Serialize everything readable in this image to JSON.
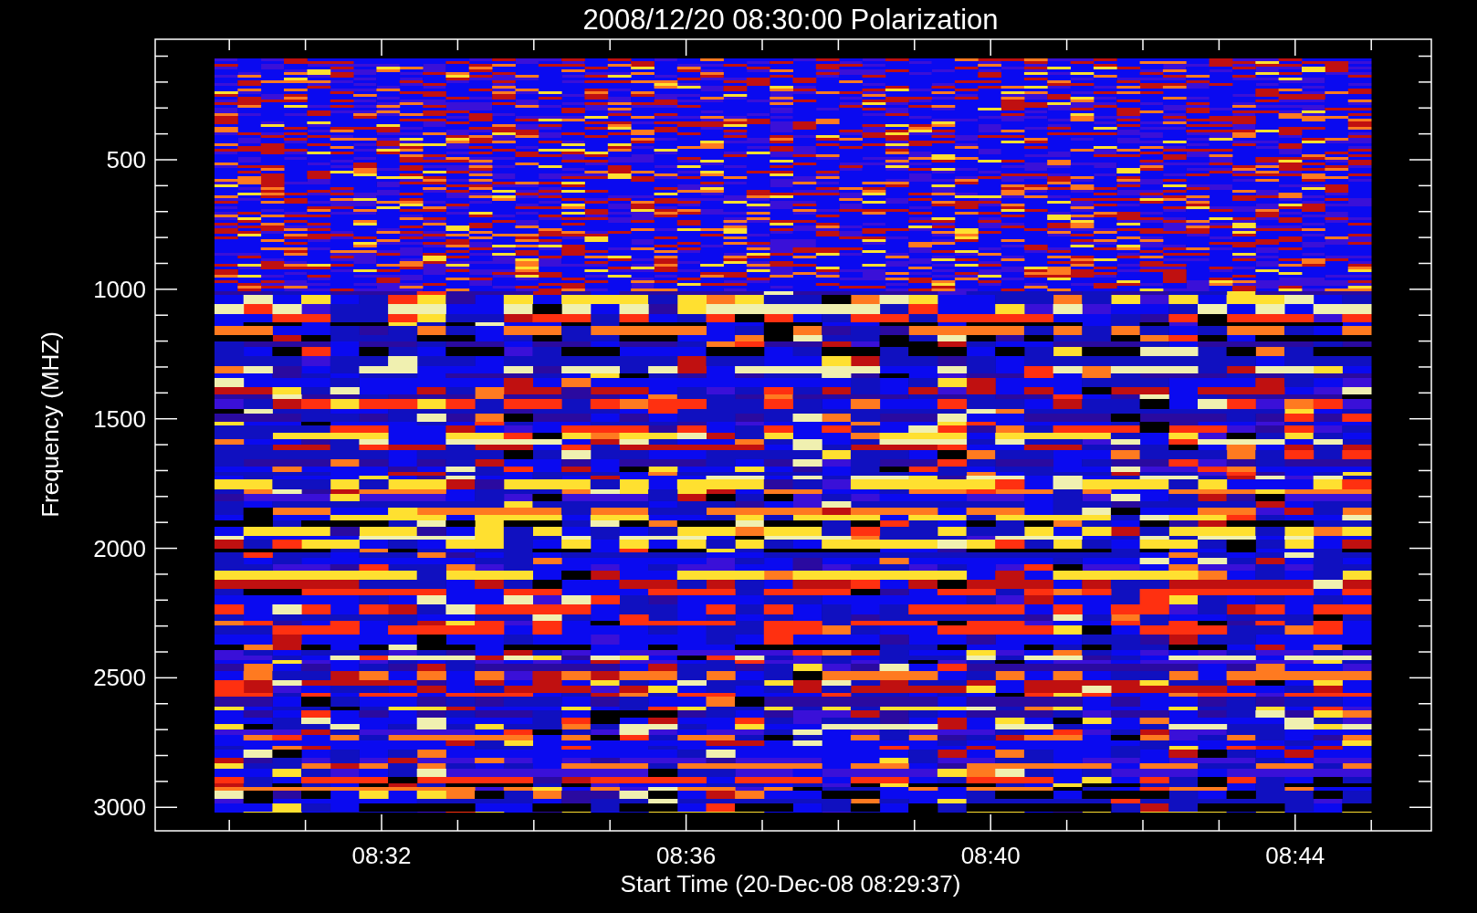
{
  "title": "2008/12/20 08:30:00 Polarization",
  "ylabel": "Frequency (MHZ)",
  "xlabel": "Start Time (20-Dec-08 08:29:37)",
  "yticks": [
    "500",
    "1000",
    "1500",
    "2000",
    "2500",
    "3000"
  ],
  "xticks": [
    "08:32",
    "08:36",
    "08:40",
    "08:44"
  ]
}
